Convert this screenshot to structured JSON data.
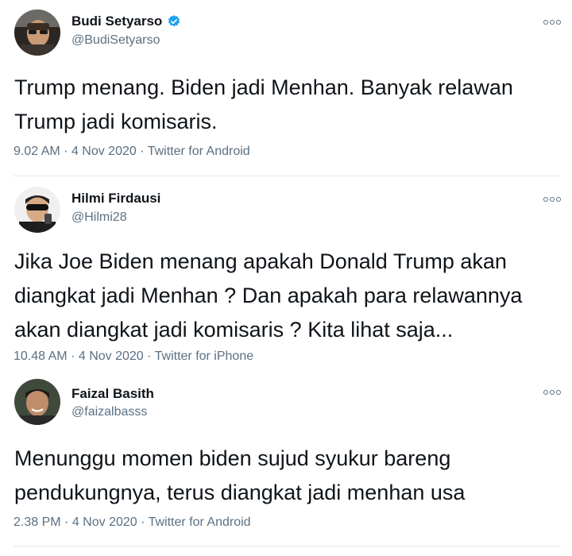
{
  "tweets": [
    {
      "name": "Budi Setyarso",
      "handle": "@BudiSetyarso",
      "verified": true,
      "text_lines": [
        "Trump menang. Biden jadi Menhan. Banyak relawan",
        "Trump jadi komisaris."
      ],
      "time": "9.02 AM",
      "date": "4 Nov 2020",
      "source": "Twitter for Android"
    },
    {
      "name": "Hilmi Firdausi",
      "handle": "@Hilmi28",
      "verified": false,
      "text_lines": [
        "Jika Joe Biden menang apakah Donald Trump akan",
        "diangkat jadi Menhan ? Dan apakah para relawannya",
        "akan diangkat jadi komisaris ? Kita lihat saja..."
      ],
      "time": "10.48 AM",
      "date": "4 Nov 2020",
      "source": "Twitter for iPhone"
    },
    {
      "name": "Faizal Basith",
      "handle": "@faizalbasss",
      "verified": false,
      "text_lines": [
        "Menunggu momen biden sujud syukur bareng",
        "pendukungnya, terus diangkat jadi menhan usa"
      ],
      "time": "2.38 PM",
      "date": "4 Nov 2020",
      "source": "Twitter for Android"
    }
  ],
  "meta_separator": "·",
  "icons": {
    "verified": "verified-badge-icon",
    "more": "more-options-icon"
  },
  "colors": {
    "verified": "#1da1f2",
    "secondary_text": "#5b7083",
    "divider": "#e1e8ed"
  }
}
